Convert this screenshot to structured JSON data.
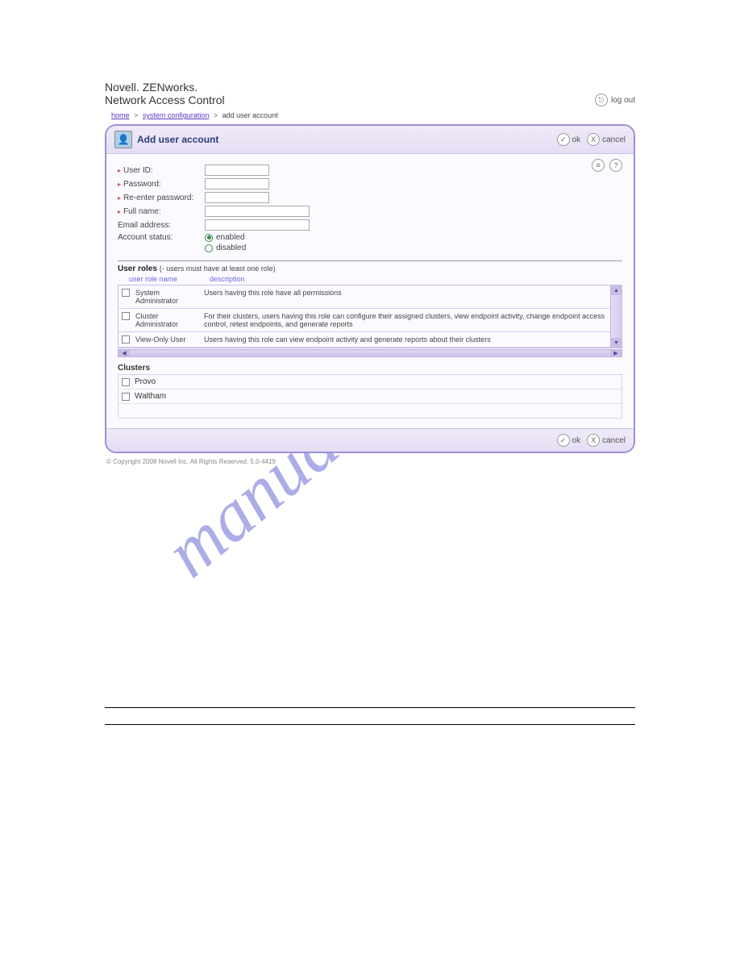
{
  "brand": {
    "line1a": "Novell",
    "line1b": "ZEN",
    "line1c": "works",
    "line2": "Network Access Control"
  },
  "logout": "log out",
  "breadcrumb": {
    "home": "home",
    "sysconf": "system configuration",
    "current": "add user account"
  },
  "panel": {
    "title": "Add user account",
    "ok": "ok",
    "cancel": "cancel"
  },
  "form": {
    "userid": "User ID:",
    "password": "Password:",
    "reenter": "Re-enter password:",
    "fullname": "Full name:",
    "email": "Email address:",
    "account_status": "Account status:",
    "enabled": "enabled",
    "disabled": "disabled"
  },
  "roles": {
    "label": "User roles",
    "note": "(- users must have at least one role)",
    "col_name": "user role name",
    "col_desc": "description",
    "rows": [
      {
        "name": "System Administrator",
        "desc": "Users having this role have all permissions"
      },
      {
        "name": "Cluster Administrator",
        "desc": "For their clusters, users having this role can configure their assigned clusters, view endpoint activity, change endpoint access control, retest endpoints, and generate reports"
      },
      {
        "name": "View-Only User",
        "desc": "Users having this role can view endpoint activity and generate reports about their clusters"
      }
    ]
  },
  "clusters": {
    "title": "Clusters",
    "items": [
      "Provo",
      "Waltham"
    ]
  },
  "copyright": "© Copyright 2008 Novell Inc. All Rights Reserved. 5.0-4419"
}
